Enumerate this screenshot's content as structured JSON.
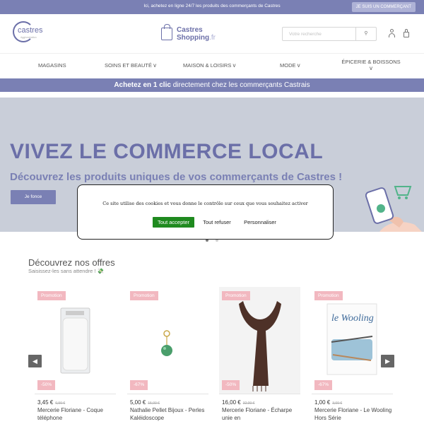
{
  "topbar": {
    "text": "Ici, achetez en ligne 24/7 les produits des commerçants de Castres",
    "merchant_button": "JE SUIS UN COMMERÇANT"
  },
  "header": {
    "logo_castres": {
      "word": "castres",
      "sub": "Agglomération"
    },
    "logo_shop": {
      "line1": "Castres",
      "line2": "Shopping",
      "line2_suffix": ".fr"
    },
    "search": {
      "placeholder": "Votre recherche",
      "button_icon": "search-icon"
    },
    "icons": [
      "user-icon",
      "cart-icon"
    ]
  },
  "nav": {
    "items": [
      {
        "label": "MAGASINS",
        "chevron": ""
      },
      {
        "label": "SOINS ET BEAUTÉ",
        "chevron": "v"
      },
      {
        "label": "MAISON & LOISIRS",
        "chevron": "v"
      },
      {
        "label": "MODE",
        "chevron": "v"
      },
      {
        "label": "ÉPICERIE & BOISSONS",
        "chevron": "v"
      }
    ]
  },
  "banner": {
    "bold": "Achetez en 1 clic",
    "rest": " directement chez les commerçants Castrais"
  },
  "hero": {
    "title": "VIVEZ LE COMMERCE LOCAL",
    "subtitle": "Découvrez les produits uniques de vos commerçants de Castres !",
    "button": "Je fonce"
  },
  "cookie": {
    "text": "Ce site utilise des cookies et vous donne le contrôle sur ceux que vous souhaitez activer",
    "accept": "Tout accepter",
    "refuse": "Tout refuser",
    "customize": "Personnaliser"
  },
  "offers": {
    "title": "Découvrez nos offres",
    "subtitle": "Saisissez-les sans attendre ! 💸",
    "prev_arrow": "◀",
    "next_arrow": "▶",
    "products": [
      {
        "promo": "Promotion",
        "discount": "-50%",
        "price": "3,45 €",
        "old_price": "6,90 €",
        "title": "Mercerie Floriane - Coque téléphone"
      },
      {
        "promo": "Promotion",
        "discount": "-67%",
        "price": "5,00 €",
        "old_price": "15,00 €",
        "title": "Nathalie Pellet Bijoux - Perles Kaléidoscope"
      },
      {
        "promo": "Promotion",
        "discount": "-50%",
        "price": "16,00 €",
        "old_price": "32,00 €",
        "title": "Mercerie Floriane - Écharpe unie en"
      },
      {
        "promo": "Promotion",
        "discount": "-67%",
        "price": "1,00 €",
        "old_price": "3,00 €",
        "title": "Mercerie Floriane - Le Wooling Hors Série"
      }
    ],
    "book_cover_text": "le Wooling"
  },
  "colors": {
    "brand": "#7a80b4",
    "brand_dark": "#6b6fa8",
    "promo": "#f2b8c0",
    "accept": "#1f8a1f"
  }
}
